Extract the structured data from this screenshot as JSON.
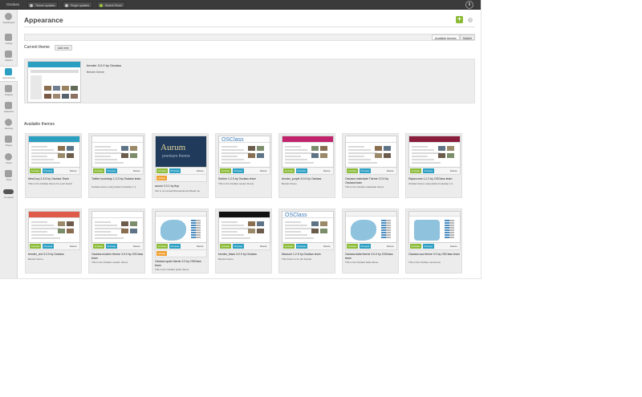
{
  "topbar": {
    "brand": "Osclass",
    "items": [
      "Theme updates",
      "Plugin updates",
      "Search Email"
    ]
  },
  "sidebar": {
    "items": [
      {
        "label": "Dashboard",
        "icon": "dashboard-icon"
      },
      {
        "label": "Listing",
        "icon": "listing-icon"
      },
      {
        "label": "Market",
        "icon": "market-icon"
      },
      {
        "label": "Appearance",
        "icon": "appearance-icon",
        "active": true
      },
      {
        "label": "Plugins",
        "icon": "plugins-icon"
      },
      {
        "label": "Statistics",
        "icon": "statistics-icon"
      },
      {
        "label": "Settings",
        "icon": "settings-icon"
      },
      {
        "label": "Pages",
        "icon": "pages-icon"
      },
      {
        "label": "Users",
        "icon": "users-icon"
      },
      {
        "label": "Tools",
        "icon": "tools-icon"
      },
      {
        "label": "Compact",
        "icon": "compact-toggle-icon"
      }
    ]
  },
  "header": {
    "title": "Appearance",
    "add_label": "+",
    "help_label": "?"
  },
  "tabs": [
    "Available themes",
    "Market"
  ],
  "current": {
    "title": "Current theme",
    "add_new": "Add new",
    "name": "bender 3.0.0 by Osclass",
    "desc": "Bender theme"
  },
  "available_title": "Available themes",
  "actions": {
    "activate": "Activate",
    "preview": "Preview",
    "delete": "Delete",
    "update": "Update"
  },
  "themes": [
    {
      "name": "NewCorp 2.4.5 by Osclass Team",
      "desc": "This is the Osclass theme for a job board",
      "style": "newcorp"
    },
    {
      "name": "Twitter bootstrap 1.3.3 by Osclass team",
      "desc": "Osclass theme using twitter bootstrap 1.4",
      "style": "twitter"
    },
    {
      "name": "aurum 2.0.1 by ftop",
      "desc": "Info in oc-content/themes/aurum/Read me",
      "style": "aurum",
      "update": true,
      "thumb_title": "Aurum",
      "thumb_sub": "premium theme"
    },
    {
      "name": "Seeker 1.2.5 by Osclass team",
      "desc": "This is the Osclass seeker theme",
      "style": "seeker",
      "thumb_logo": "OSClass"
    },
    {
      "name": "bender_purple 3.0.0 by Osclass",
      "desc": "Bender theme",
      "style": "purple"
    },
    {
      "name": "Osclass realestate Theme 2.0.0 by Osclass team",
      "desc": "This is the Osclass realestate theme",
      "style": "realestate"
    },
    {
      "name": "Rapscones 1.2.2 by OSClass team",
      "desc": "Osclass theme using twitter bootstrap 1.4",
      "style": "rapscones"
    },
    {
      "name": "bender_red 3.0.0 by Osclass",
      "desc": "Bender theme",
      "style": "red"
    },
    {
      "name": "Osclass modern theme 3.0.0 by OSClass team",
      "desc": "This is the Osclass modern theme",
      "style": "modern"
    },
    {
      "name": "Osclass spain theme 2.0 by OSClass team",
      "desc": "This is the Osclass spain theme",
      "style": "spain",
      "update": true
    },
    {
      "name": "bender_black 3.0.0 by Osclass",
      "desc": "Bender theme",
      "style": "black"
    },
    {
      "name": "Mazzoni 1.2.5 by Osclass team",
      "desc": "This theme is for job boards",
      "style": "mazzoni",
      "thumb_logo": "OSClass"
    },
    {
      "name": "Osclass italia theme 3.0.0 by OSClass team",
      "desc": "This is the Osclass italia theme",
      "style": "italia"
    },
    {
      "name": "Osclass usa theme 3.0 by OSClass team",
      "desc": "This is the Osclass usa theme",
      "style": "usa"
    }
  ],
  "colors": {
    "activate": "#8bbb37",
    "preview": "#2b9fc2",
    "update": "#f0a030",
    "topbar": "#3b3b3b"
  }
}
